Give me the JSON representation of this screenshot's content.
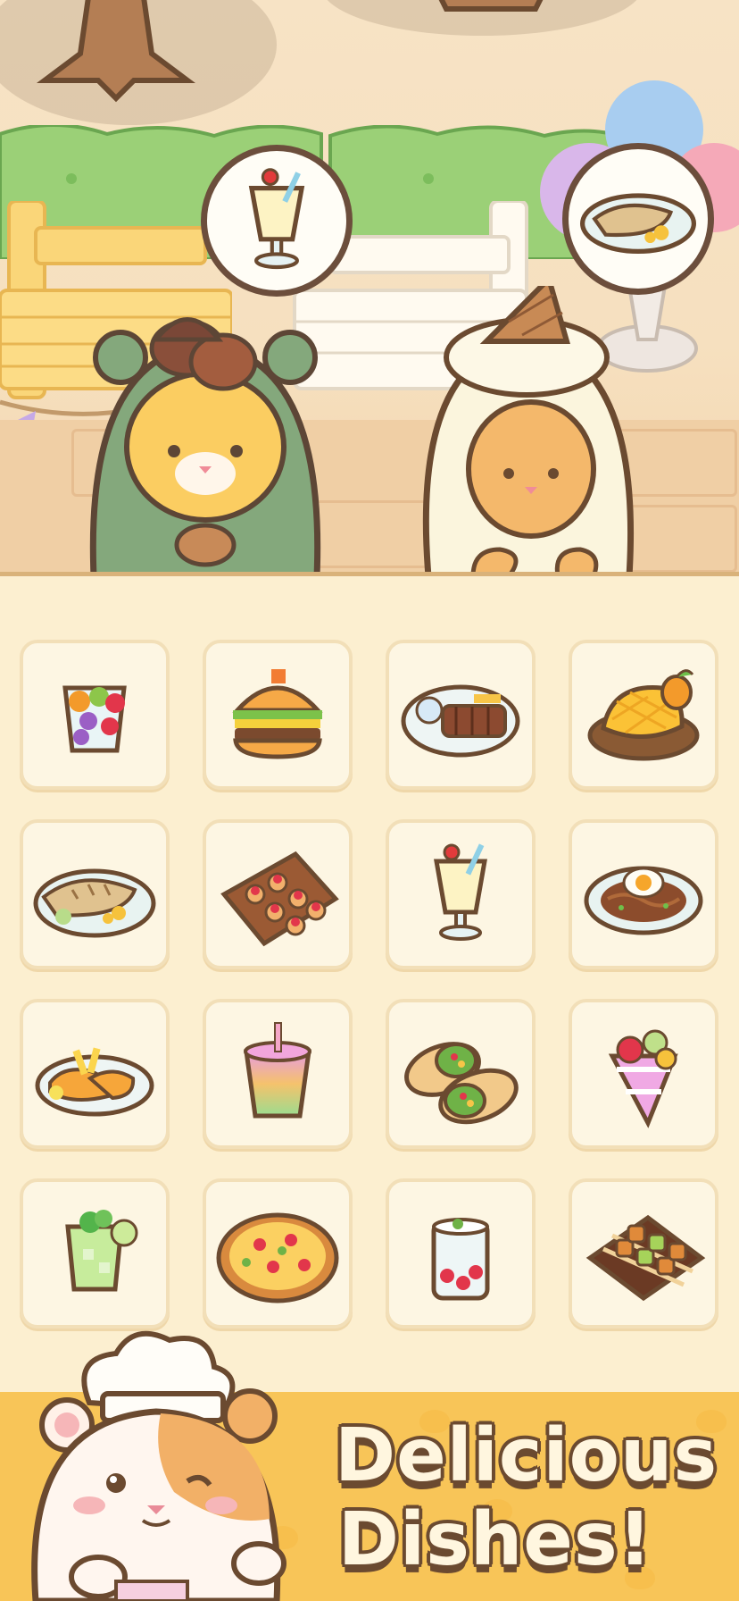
{
  "banner": {
    "headline_line1": "Delicious",
    "headline_line2": "Dishes!"
  },
  "customers": [
    {
      "name_icon": "green-bear-hood-customer",
      "order": "milkshake"
    },
    {
      "name_icon": "sheep-hood-customer",
      "order": "grilled-fish"
    }
  ],
  "dishes": [
    "fruit-cup",
    "burger",
    "bbq-ribs-platter",
    "mango",
    "grilled-fish",
    "bruschetta-tray",
    "milkshake",
    "fried-egg-noodles",
    "fish-and-chips",
    "rainbow-smoothie",
    "burrito",
    "crepe",
    "mojito",
    "pizza",
    "strawberry-drink",
    "skewers"
  ],
  "colors": {
    "outline": "#6b4a30",
    "banner": "#f8c558",
    "menu_background": "#fcefd0",
    "tile": "#fdf6e3"
  }
}
